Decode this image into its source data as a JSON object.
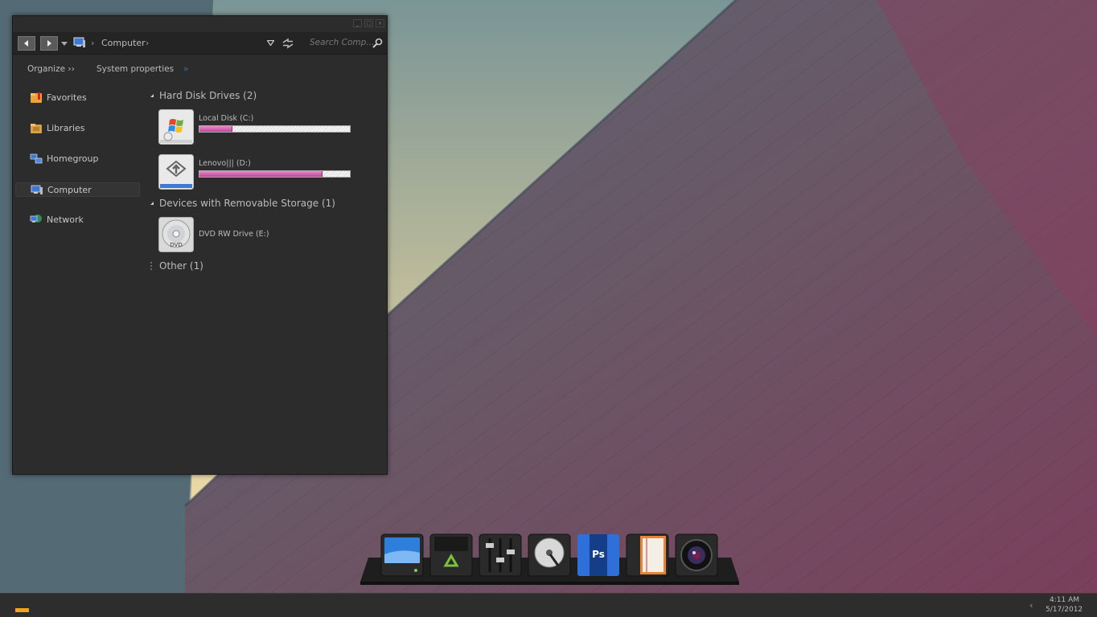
{
  "window": {
    "breadcrumb": "Computer",
    "search_placeholder": "Search Comp...",
    "toolbar": {
      "organize": "Organize ››",
      "system_properties": "System properties",
      "more": "»"
    },
    "nav_items": [
      {
        "label": "Favorites",
        "icon": "star-folder-icon"
      },
      {
        "label": "Libraries",
        "icon": "libraries-folder-icon"
      },
      {
        "label": "Homegroup",
        "icon": "homegroup-icon"
      },
      {
        "label": "Computer",
        "icon": "computer-icon",
        "selected": true
      },
      {
        "label": "Network",
        "icon": "network-icon"
      }
    ],
    "groups": {
      "hard_disks": "Hard Disk Drives (2)",
      "removable": "Devices with Removable Storage (1)",
      "other": "Other (1)"
    },
    "drives": [
      {
        "label": "Local Disk (C:)",
        "used_fraction": 0.22,
        "icon": "windows-drive-icon"
      },
      {
        "label": "Lenovo||| (D:)",
        "used_fraction": 0.82,
        "icon": "drive-icon"
      },
      {
        "label": "DVD RW Drive (E:)",
        "icon": "dvd-drive-icon"
      }
    ]
  },
  "dock": [
    {
      "name": "monitor-app-icon"
    },
    {
      "name": "recycle-bin-icon"
    },
    {
      "name": "mixer-settings-icon"
    },
    {
      "name": "hard-disk-icon"
    },
    {
      "name": "photoshop-icon",
      "text": "Ps"
    },
    {
      "name": "notebook-icon"
    },
    {
      "name": "camera-icon"
    }
  ],
  "taskbar": {
    "time": "4:11 AM",
    "date": "5/17/2012",
    "chevron": "‹"
  },
  "colors": {
    "usage_bar": "#d763b4",
    "start_button": "#f5a31a",
    "window_bg": "#2c2c2c"
  }
}
